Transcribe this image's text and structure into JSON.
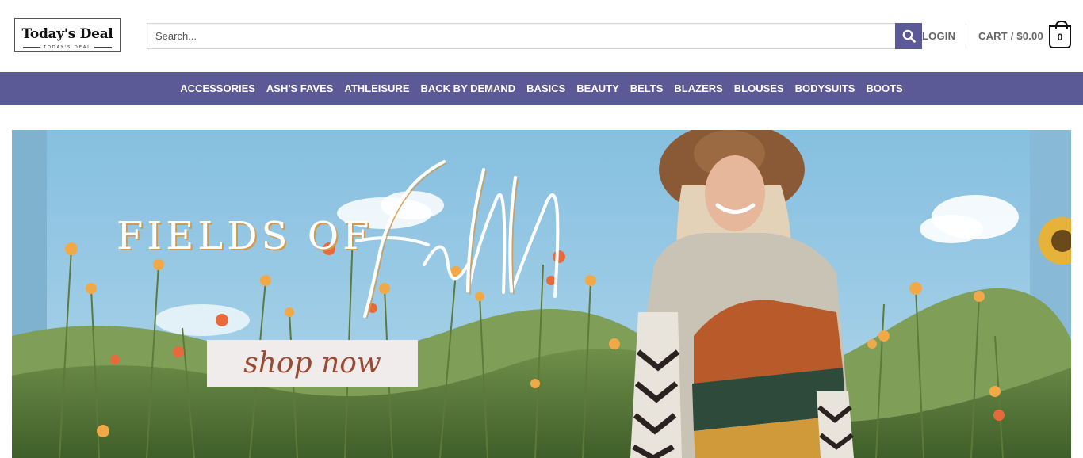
{
  "header": {
    "logo_title": "Today's Deal",
    "logo_subtitle": "TODAY'S DEAL",
    "search_placeholder": "Search...",
    "login_label": "LOGIN",
    "cart_label": "CART / $0.00",
    "cart_count": "0"
  },
  "nav": {
    "items": [
      "ACCESSORIES",
      "ASH'S FAVES",
      "ATHLEISURE",
      "BACK BY DEMAND",
      "BASICS",
      "BEAUTY",
      "BELTS",
      "BLAZERS",
      "BLOUSES",
      "BODYSUITS",
      "BOOTS"
    ]
  },
  "hero": {
    "heading": "FIELDS OF",
    "script_word": "fall",
    "cta_label": "shop now"
  },
  "colors": {
    "brand": "#5c5a96",
    "sky": "#8fc3e0",
    "accent_gold": "#d49a4a",
    "cta_text": "#9a4a33"
  },
  "icons": {
    "search": "search-icon",
    "cart": "cart-bag-icon"
  }
}
